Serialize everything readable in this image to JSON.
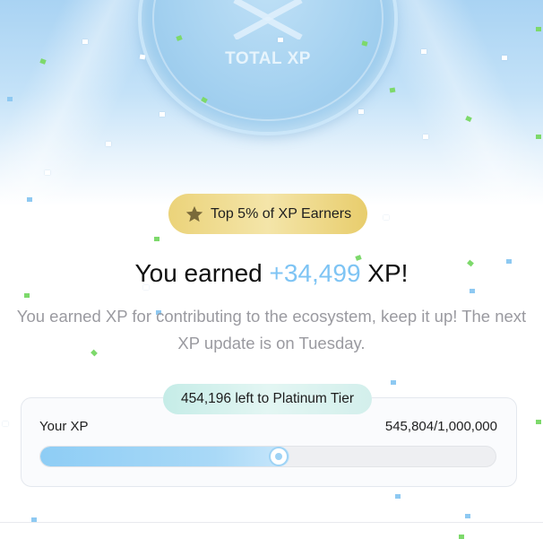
{
  "medal": {
    "label": "TOTAL XP",
    "logo_icon": "x-chevron-logo-icon"
  },
  "badge": {
    "icon": "star-icon",
    "text": "Top 5% of XP Earners"
  },
  "headline": {
    "prefix": "You earned ",
    "amount": "+34,499",
    "suffix": " XP!"
  },
  "subtext": "You earned XP for contributing to the ecosystem, keep it up! The next XP update is on Tuesday.",
  "progress": {
    "tier_pill": "454,196 left to Platinum Tier",
    "label": "Your XP",
    "value_text": "545,804/1,000,000",
    "current": 545804,
    "target": 1000000
  },
  "colors": {
    "accent_blue": "#7ec4f4",
    "badge_gold": "#ebd37a",
    "tier_pill_teal": "#c5ece7",
    "confetti_green": "#7dd96b",
    "confetti_blue": "#8ec9f2",
    "confetti_white": "#ffffff"
  }
}
